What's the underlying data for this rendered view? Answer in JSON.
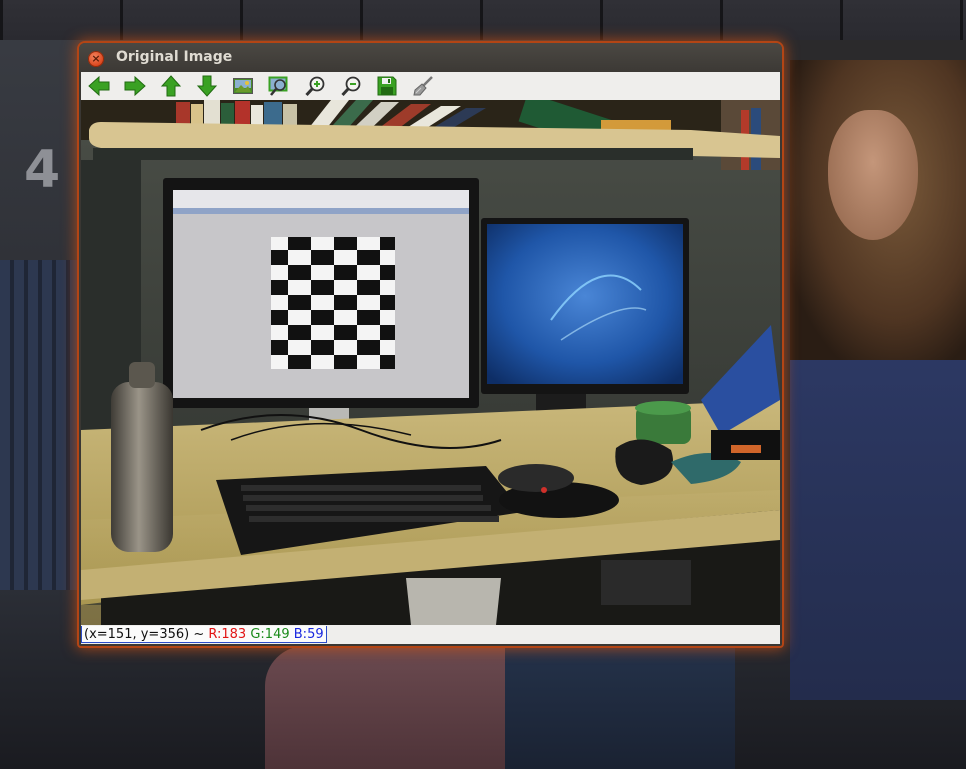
{
  "window": {
    "title": "Original Image",
    "close_glyph": "×"
  },
  "toolbar": {
    "buttons": [
      {
        "icon": "arrow-left-icon",
        "color": "#3aa123"
      },
      {
        "icon": "arrow-right-icon",
        "color": "#3aa123"
      },
      {
        "icon": "arrow-up-icon",
        "color": "#3aa123"
      },
      {
        "icon": "arrow-down-icon",
        "color": "#3aa123"
      },
      {
        "icon": "image-fit-icon",
        "color": "#3aa123"
      },
      {
        "icon": "zoom-region-icon",
        "color": "#3aa123"
      },
      {
        "icon": "zoom-in-icon",
        "color": "#3aa123"
      },
      {
        "icon": "zoom-out-icon",
        "color": "#3aa123"
      },
      {
        "icon": "save-icon",
        "color": "#3aa123"
      },
      {
        "icon": "properties-brush-icon",
        "color": "#8a8a8a"
      }
    ]
  },
  "status": {
    "coords": "(x=151, y=356) ~",
    "r": "R:183",
    "g": "G:149",
    "b": "B:59"
  },
  "colors": {
    "window_glow": "#b34515",
    "toolbar_bg": "#efeeec",
    "icon_green": "#3aa123"
  }
}
